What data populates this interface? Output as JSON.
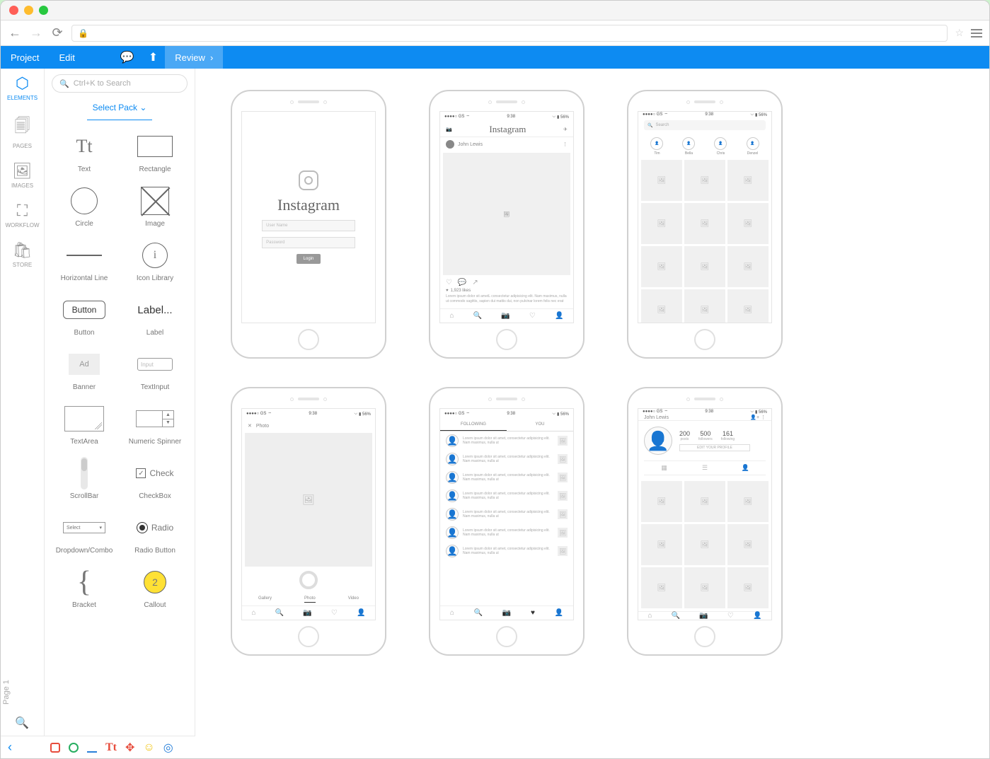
{
  "toolbar": {
    "project": "Project",
    "edit": "Edit",
    "review": "Review"
  },
  "rail": {
    "elements": "ELEMENTS",
    "pages": "PAGES",
    "images": "IMAGES",
    "workflow": "WORKFLOW",
    "store": "STORE",
    "page_label": "Page 1"
  },
  "sidepanel": {
    "search_placeholder": "Ctrl+K to Search",
    "select_pack": "Select Pack",
    "elements": [
      {
        "label": "Text",
        "type": "text",
        "preview": "Tt"
      },
      {
        "label": "Rectangle",
        "type": "rect"
      },
      {
        "label": "Circle",
        "type": "circle"
      },
      {
        "label": "Image",
        "type": "image"
      },
      {
        "label": "Horizontal Line",
        "type": "hline"
      },
      {
        "label": "Icon Library",
        "type": "iconlib",
        "preview": "i"
      },
      {
        "label": "Button",
        "type": "button",
        "preview": "Button"
      },
      {
        "label": "Label",
        "type": "label",
        "preview": "Label..."
      },
      {
        "label": "Banner",
        "type": "banner",
        "preview": "Ad"
      },
      {
        "label": "TextInput",
        "type": "input",
        "preview": "Input"
      },
      {
        "label": "TextArea",
        "type": "textarea"
      },
      {
        "label": "Numeric Spinner",
        "type": "spinner"
      },
      {
        "label": "ScrollBar",
        "type": "scroll"
      },
      {
        "label": "CheckBox",
        "type": "check",
        "preview": "Check"
      },
      {
        "label": "Dropdown/Combo",
        "type": "dropdown",
        "preview": "Select"
      },
      {
        "label": "Radio Button",
        "type": "radio",
        "preview": "Radio"
      },
      {
        "label": "Bracket",
        "type": "bracket",
        "preview": "{"
      },
      {
        "label": "Callout",
        "type": "callout",
        "preview": "2"
      }
    ]
  },
  "mockups": {
    "status": {
      "signal": "●●●●○ GS",
      "wifi": "⌔",
      "time": "9:38",
      "bt": "⌵",
      "batt": "▮ 56%"
    },
    "login": {
      "brand": "Instagram",
      "username_ph": "User Name",
      "password_ph": "Password",
      "login_btn": "Login"
    },
    "feed": {
      "brand": "Instagram",
      "author": "John Lewis",
      "likes": "1,923 likes",
      "caption": "Lorem ipsum dolor sit ametL consectetur adipisicing elit. Nam maximus, nulla ut commodo sagittis, sapien dui mattis dui, non pulvinar lorem felis nec erat"
    },
    "explore": {
      "search_ph": "Search",
      "avatars": [
        "Tim",
        "Bella",
        "Chris",
        "Denzel"
      ]
    },
    "camera": {
      "header": "Photo",
      "tabs": [
        "Gallery",
        "Photo",
        "Video"
      ]
    },
    "activity": {
      "tabs": [
        "FOLLOWING",
        "YOU"
      ],
      "item_text": "Lorem ipsum dolor sit amet, consectetur adipisicing elit. Nam maximus, nulla ut"
    },
    "profile": {
      "name": "John Lewis",
      "stats": [
        {
          "num": "200",
          "lbl": "posts"
        },
        {
          "num": "500",
          "lbl": "followers"
        },
        {
          "num": "161",
          "lbl": "following"
        }
      ],
      "edit_btn": "EDIT YOUR PROFILE"
    }
  }
}
